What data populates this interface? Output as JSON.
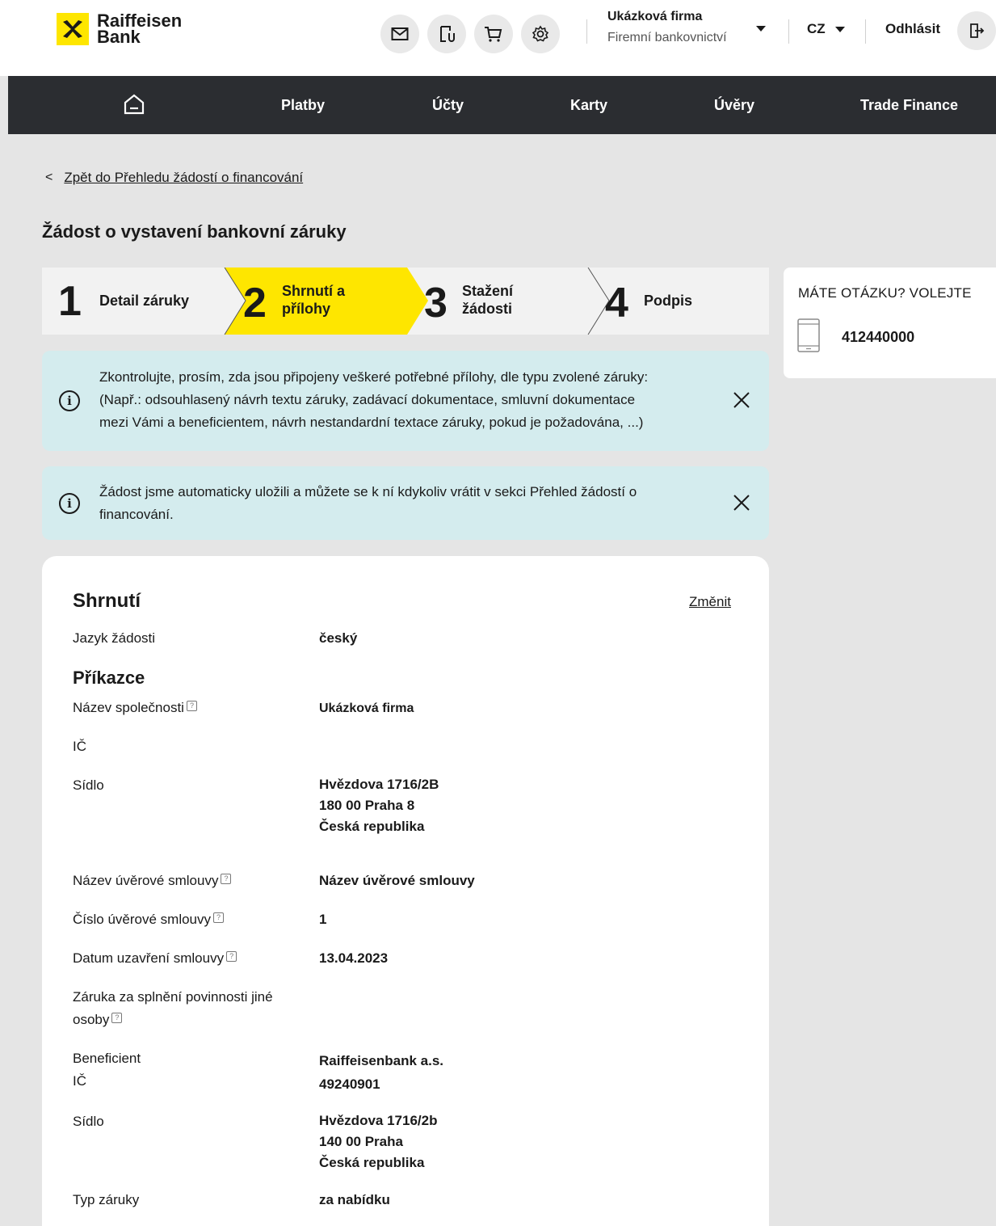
{
  "header": {
    "brand_line1": "Raiffeisen",
    "brand_line2": "Bank",
    "company_name": "Ukázková firma",
    "company_sub": "Firemní bankovnictví",
    "language": "CZ",
    "logout_label": "Odhlásit"
  },
  "nav": {
    "items": [
      "Platby",
      "Účty",
      "Karty",
      "Úvěry",
      "Trade Finance"
    ]
  },
  "back_link": "Zpět do Přehledu žádostí o financování",
  "page_title": "Žádost o vystavení bankovní záruky",
  "stepper": {
    "steps": [
      {
        "num": "1",
        "label": "Detail záruky"
      },
      {
        "num": "2",
        "label_line1": "Shrnutí a",
        "label_line2": "přílohy"
      },
      {
        "num": "3",
        "label_line1": "Stažení",
        "label_line2": "žádosti"
      },
      {
        "num": "4",
        "label": "Podpis"
      }
    ],
    "active_color": "#fee600"
  },
  "help": {
    "title": "MÁTE OTÁZKU? VOLEJTE",
    "phone": "412440000"
  },
  "alerts": [
    {
      "line1": "Zkontrolujte, prosím, zda jsou připojeny veškeré potřebné přílohy, dle typu zvolené záruky:",
      "line2": "(Např.: odsouhlasený návrh textu záruky, zadávací dokumentace, smluvní dokumentace",
      "line3": "mezi Vámi a beneficientem, návrh nestandardní textace záruky, pokud je požadována, ...)"
    },
    {
      "line1": "Žádost jsme automaticky uložili a můžete se k ní kdykoliv vrátit v sekci  Přehled žádostí o",
      "line2": "financování."
    }
  ],
  "summary": {
    "title": "Shrnutí",
    "change_label": "Změnit",
    "section_prikazce": "Příkazce",
    "rows": {
      "jazyk_label": "Jazyk žádosti",
      "jazyk_value": "český",
      "nazev_spol_label": "Název společnosti",
      "nazev_spol_value": "Ukázková firma",
      "ic_label": "IČ",
      "sidlo_label": "Sídlo",
      "sidlo_line1": "Hvězdova  1716/2B",
      "sidlo_line2": "180 00  Praha 8",
      "sidlo_line3": "Česká republika",
      "nazev_smlouvy_label": "Název úvěrové smlouvy",
      "nazev_smlouvy_value": "Název úvěrové smlouvy",
      "cislo_smlouvy_label": "Číslo úvěrové smlouvy",
      "cislo_smlouvy_value": "1",
      "datum_label": "Datum uzavření smlouvy",
      "datum_value": "13.04.2023",
      "zaruka_jine_line1": "Záruka za splnění povinnosti jiné",
      "zaruka_jine_line2": "osoby",
      "benef_label": "Beneficient",
      "benef_value": "Raiffeisenbank a.s.",
      "benef_ic_label": "IČ",
      "benef_ic_value": "49240901",
      "benef_sidlo_label": "Sídlo",
      "benef_sidlo_line1": "Hvězdova  1716/2b",
      "benef_sidlo_line2": "140 00  Praha",
      "benef_sidlo_line3": "Česká republika",
      "typ_label": "Typ záruky",
      "typ_value": "za nabídku"
    }
  }
}
